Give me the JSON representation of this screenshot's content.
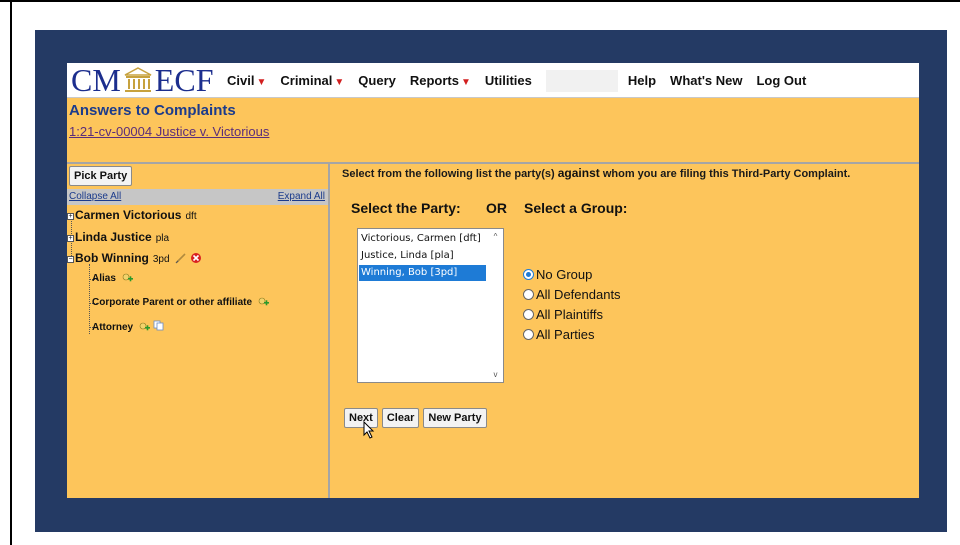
{
  "logo": {
    "part1": "CM",
    "part2": "ECF"
  },
  "menu": {
    "items": [
      {
        "label": "Civil",
        "dropdown": true
      },
      {
        "label": "Criminal",
        "dropdown": true
      },
      {
        "label": "Query",
        "dropdown": false
      },
      {
        "label": "Reports",
        "dropdown": true
      },
      {
        "label": "Utilities",
        "dropdown": false
      }
    ],
    "right_items": [
      "Help",
      "What's New",
      "Log Out"
    ]
  },
  "header": {
    "title": "Answers to Complaints",
    "case_link": "1:21-cv-00004 Justice v. Victorious"
  },
  "left": {
    "pick_party": "Pick Party",
    "collapse_all": "Collapse All",
    "expand_all": "Expand All",
    "parties": [
      {
        "name": "Carmen Victorious",
        "role": "dft",
        "expanded": false
      },
      {
        "name": "Linda Justice",
        "role": "pla",
        "expanded": false
      },
      {
        "name": "Bob Winning",
        "role": "3pd",
        "expanded": true
      }
    ],
    "children": [
      "Alias",
      "Corporate Parent or other affiliate",
      "Attorney"
    ]
  },
  "main": {
    "instruction_pre": "Select from the following list the party(s) ",
    "instruction_kw": "against",
    "instruction_post": " whom you are filing this Third-Party Complaint.",
    "select_party_label": "Select the Party:",
    "or_label": "OR",
    "select_group_label": "Select a Group:",
    "party_options": [
      {
        "label": "Victorious, Carmen [dft]",
        "selected": false
      },
      {
        "label": "Justice, Linda [pla]",
        "selected": false
      },
      {
        "label": "Winning, Bob [3pd]",
        "selected": true
      }
    ],
    "groups": [
      {
        "label": "No Group",
        "checked": true
      },
      {
        "label": "All Defendants",
        "checked": false
      },
      {
        "label": "All Plaintiffs",
        "checked": false
      },
      {
        "label": "All Parties",
        "checked": false
      }
    ],
    "buttons": {
      "next": "Next",
      "clear": "Clear",
      "new_party": "New Party"
    }
  },
  "colors": {
    "frame": "#243a64",
    "panel": "#fdc55b",
    "title_blue": "#1b3b8c",
    "selection": "#1e7bd6",
    "caret_red": "#d21f1f"
  }
}
